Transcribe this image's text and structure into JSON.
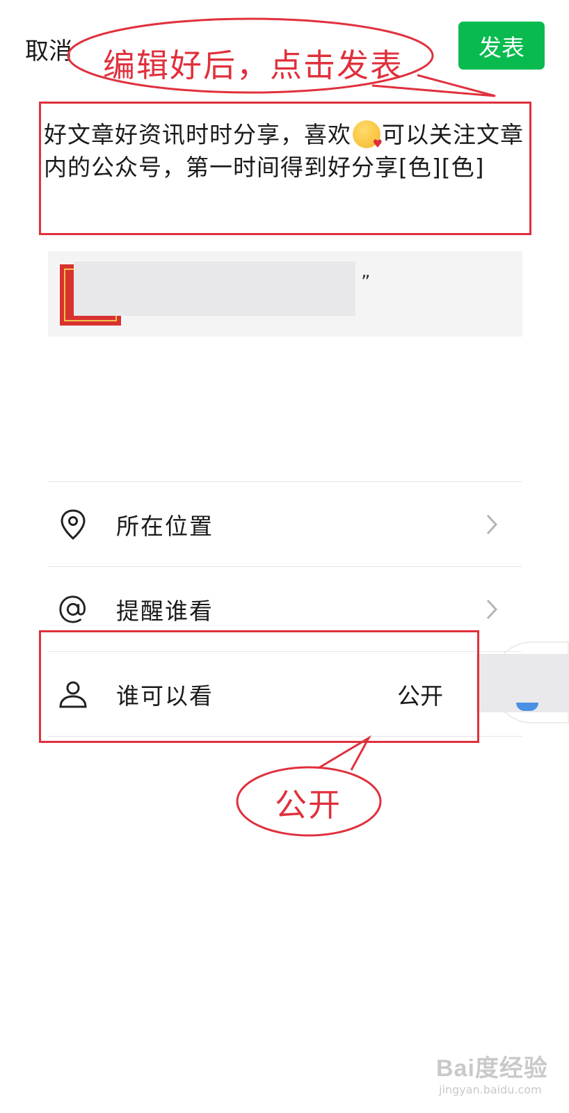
{
  "header": {
    "cancel_label": "取消",
    "publish_label": "发表"
  },
  "post": {
    "text_before_emoji": "好文章好资讯时时分享，喜欢",
    "emoji_icon": "kissing-face-emoji",
    "text_after_emoji": "可以关注文章内的公众号，第一时间得到好分享[色][色]"
  },
  "link_card": {
    "visible_tail": "”"
  },
  "options": [
    {
      "label": "所在位置",
      "icon": "location-pin-icon",
      "value": "",
      "chevron": true
    },
    {
      "label": "提醒谁看",
      "icon": "at-sign-icon",
      "value": "",
      "chevron": true
    },
    {
      "label": "谁可以看",
      "icon": "person-icon",
      "value": "公开",
      "chevron": false
    }
  ],
  "annotations": {
    "top_callout": "编辑好后，点击发表",
    "bottom_callout": "公开",
    "color": "#e0303d"
  },
  "watermark": {
    "main": "Bai度经验",
    "sub": "jingyan.baidu.com"
  },
  "colors": {
    "publish_button": "#09bb4f",
    "annotation": "#e0303d"
  }
}
